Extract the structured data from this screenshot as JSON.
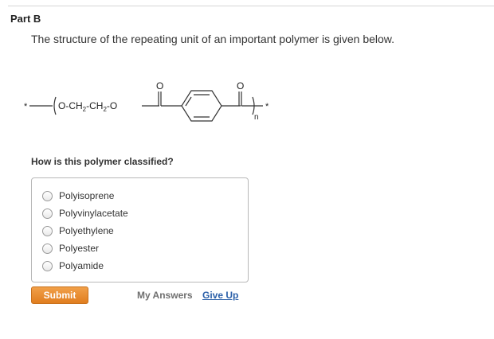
{
  "part": {
    "title": "Part B"
  },
  "prompt": "The structure of the repeating unit of an important polymer is given below.",
  "structure": {
    "left_cap": "*",
    "chain": "O-CH",
    "sub1": "2",
    "chain2": "-CH",
    "sub2": "2",
    "chain3": "-O",
    "carbonyl_o1": "O",
    "carbonyl_o2": "O",
    "repeat_n": "n",
    "right_cap": "*"
  },
  "question": "How is this polymer classified?",
  "options": [
    {
      "label": "Polyisoprene",
      "selected": false
    },
    {
      "label": "Polyvinylacetate",
      "selected": false
    },
    {
      "label": "Polyethylene",
      "selected": false
    },
    {
      "label": "Polyester",
      "selected": false
    },
    {
      "label": "Polyamide",
      "selected": false
    }
  ],
  "actions": {
    "submit": "Submit",
    "my_answers": "My Answers",
    "give_up": "Give Up"
  }
}
